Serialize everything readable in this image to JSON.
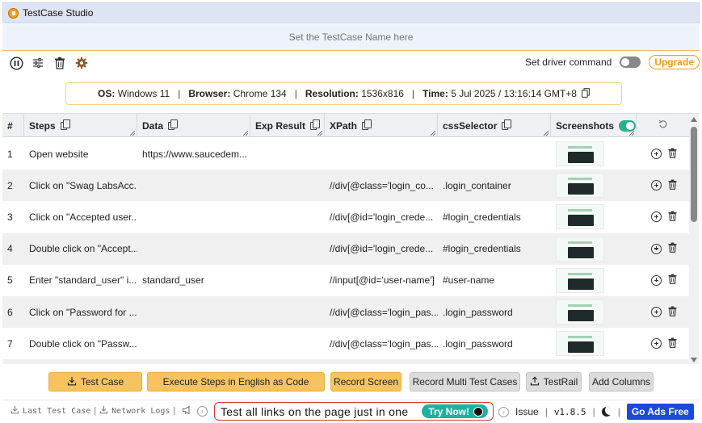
{
  "window": {
    "title": "TestCase Studio"
  },
  "name_bar": {
    "placeholder": "Set the TestCase Name here"
  },
  "toolbar": {
    "driver_label": "Set driver command",
    "upgrade_label": "Upgrade"
  },
  "info": {
    "os_label": "OS:",
    "os_value": "Windows 11",
    "browser_label": "Browser:",
    "browser_value": "Chrome 134",
    "resolution_label": "Resolution:",
    "resolution_value": "1536x816",
    "time_label": "Time:",
    "time_value": "5 Jul 2025 / 13:16:14 GMT+8",
    "separator": "|"
  },
  "table": {
    "headers": {
      "num": "#",
      "steps": "Steps",
      "data": "Data",
      "exp": "Exp Result",
      "xpath": "XPath",
      "css": "cssSelector",
      "screens": "Screenshots"
    },
    "rows": [
      {
        "num": "1",
        "step": "Open website",
        "data": "https://www.saucedem...",
        "xpath": "",
        "css": ""
      },
      {
        "num": "2",
        "step": "Click on \"Swag LabsAcc...",
        "data": "",
        "xpath": "//div[@class='login_co...",
        "css": ".login_container"
      },
      {
        "num": "3",
        "step": "Click on \"Accepted user...",
        "data": "",
        "xpath": "//div[@id='login_crede...",
        "css": "#login_credentials"
      },
      {
        "num": "4",
        "step": "Double click on \"Accept...",
        "data": "",
        "xpath": "//div[@id='login_crede...",
        "css": "#login_credentials"
      },
      {
        "num": "5",
        "step": "Enter \"standard_user\" i...",
        "data": "standard_user",
        "xpath": "//input[@id='user-name']",
        "css": "#user-name"
      },
      {
        "num": "6",
        "step": "Click on \"Password for ...",
        "data": "",
        "xpath": "//div[@class='login_pas...",
        "css": ".login_password"
      },
      {
        "num": "7",
        "step": "Double click on \"Passw...",
        "data": "",
        "xpath": "//div[@class='login_pas...",
        "css": ".login_password"
      }
    ]
  },
  "actions": {
    "test_case": "Test Case",
    "execute": "Execute Steps in English as Code",
    "record_screen": "Record Screen",
    "record_multi": "Record Multi Test Cases",
    "testrail": "TestRail",
    "add_columns": "Add Columns"
  },
  "footer": {
    "last_test_case": "Last Test Case",
    "network_logs": "Network Logs",
    "separator": "|",
    "marquee_text": "Test all links on the page just in one",
    "try_now": "Try Now!",
    "issue": "Issue",
    "version": "v1.8.5",
    "ads": "Go Ads Free"
  },
  "colors": {
    "accent": "#f6c35f",
    "toggle_on": "#27b08c",
    "ads_blue": "#1a4ad6",
    "marquee_border": "#d9352f"
  }
}
